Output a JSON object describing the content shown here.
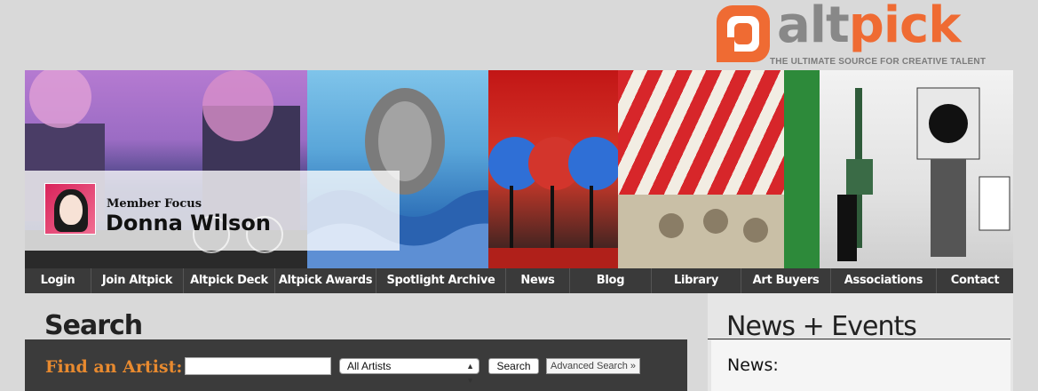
{
  "brand": {
    "logo_alt": "alt",
    "logo_pick": "pick",
    "tagline": "THE ULTIMATE SOURCE FOR CREATIVE TALENT",
    "accent": "#ef6b33"
  },
  "member_focus": {
    "label": "Member Focus",
    "name": "Donna Wilson"
  },
  "nav": {
    "items": [
      {
        "label": "Login"
      },
      {
        "label": "Join Altpick"
      },
      {
        "label": "Altpick Deck"
      },
      {
        "label": "Altpick Awards"
      },
      {
        "label": "Spotlight Archive"
      },
      {
        "label": "News"
      },
      {
        "label": "Blog"
      },
      {
        "label": "Library"
      },
      {
        "label": "Art Buyers"
      },
      {
        "label": "Associations"
      },
      {
        "label": "Contact"
      }
    ]
  },
  "search": {
    "title": "Search",
    "find_label": "Find an Artist:",
    "input_value": "",
    "select_value": "All Artists",
    "button_label": "Search",
    "advanced_label": "Advanced Search »"
  },
  "news": {
    "title": "News + Events",
    "subtitle": "News:"
  }
}
